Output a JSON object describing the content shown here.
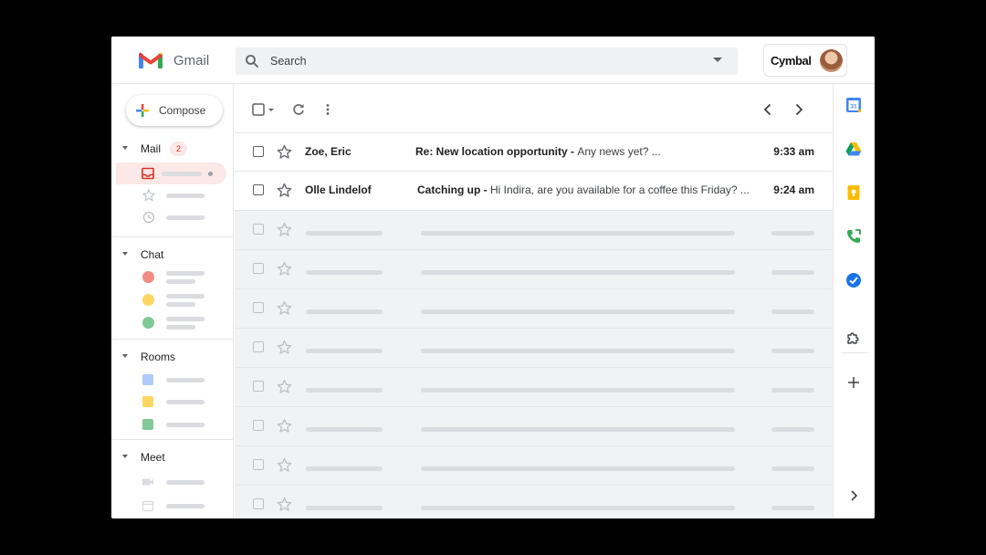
{
  "app": {
    "brand": "Gmail"
  },
  "search": {
    "placeholder": "Search"
  },
  "account": {
    "org": "Cymbal"
  },
  "compose": {
    "label": "Compose"
  },
  "sidebar": {
    "sections": [
      {
        "label": "Mail",
        "badge": "2"
      },
      {
        "label": "Chat"
      },
      {
        "label": "Rooms"
      },
      {
        "label": "Meet"
      }
    ]
  },
  "emails": [
    {
      "sender": "Zoe, Eric",
      "subject": "Re: New location opportunity - ",
      "snippet": "Any news yet? ...",
      "time": "9:33 am"
    },
    {
      "sender": "Olle Lindelof",
      "subject": "Catching up - ",
      "snippet": "Hi Indira, are you available for a coffee this Friday? ...",
      "time": "9:24 am"
    }
  ],
  "colors": {
    "accent_red": "#ea4335",
    "badge_bg": "#fce8e6",
    "chat_dots": [
      "#f28b82",
      "#fdd663",
      "#81c995"
    ],
    "room_squares": [
      "#aecbfa",
      "#fdd663",
      "#81c995"
    ]
  },
  "icons": {
    "rail": [
      "calendar-icon",
      "drive-icon",
      "keep-icon",
      "voice-icon",
      "tasks-icon",
      "add-ons-icon",
      "add-icon",
      "expand-panel-icon"
    ]
  }
}
